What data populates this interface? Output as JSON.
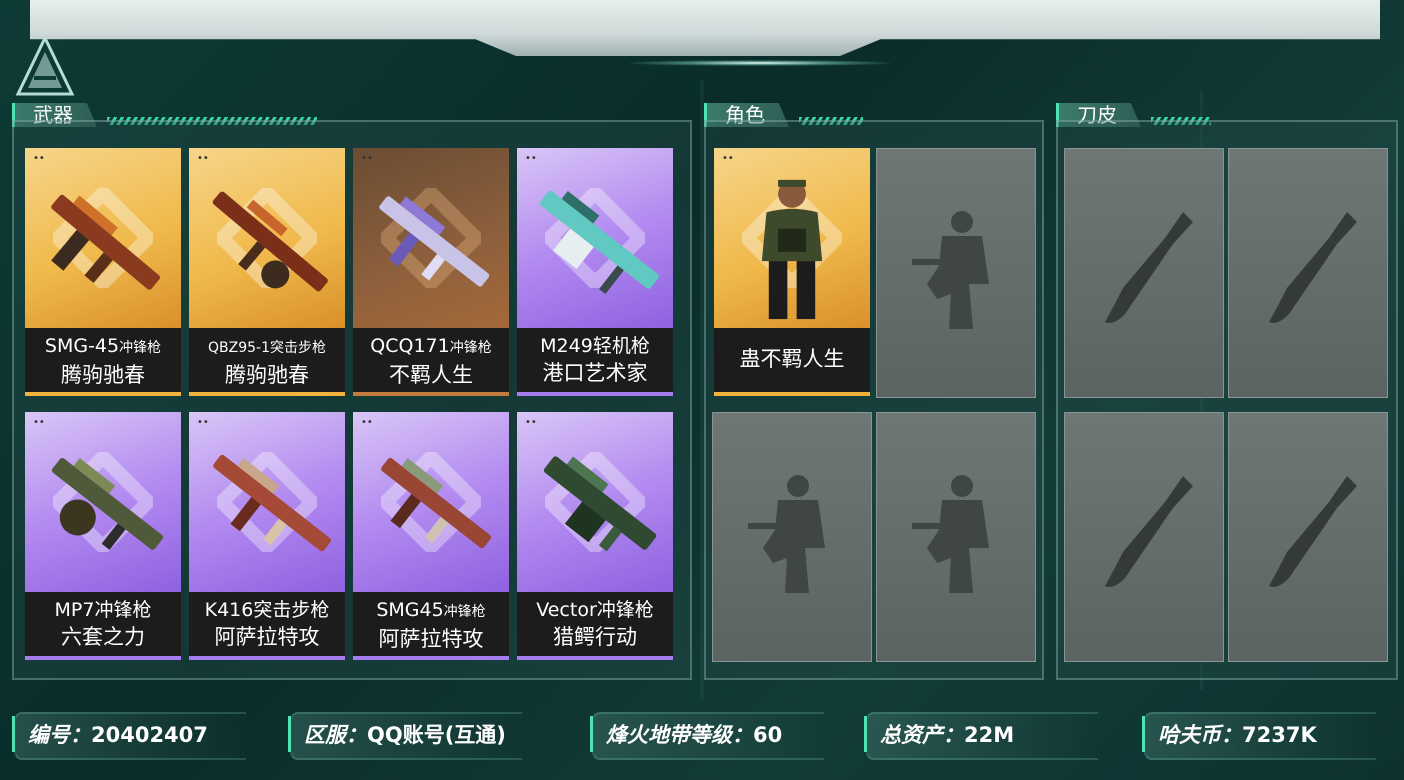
{
  "sections": {
    "weapons": "武器",
    "characters": "角色",
    "knives": "刀皮"
  },
  "weapons": [
    {
      "name": "SMG-45",
      "type": "冲锋枪",
      "skin": "腾驹驰春",
      "rarity": "gold"
    },
    {
      "name": "QBZ95-1",
      "type": "突击步枪",
      "skin": "腾驹驰春",
      "rarity": "gold"
    },
    {
      "name": "QCQ171",
      "type": "冲锋枪",
      "skin": "不羁人生",
      "rarity": "bronze"
    },
    {
      "name": "M249",
      "type": "轻机枪",
      "skin": "港口艺术家",
      "rarity": "purple"
    },
    {
      "name": "MP7",
      "type": "冲锋枪",
      "skin": "六套之力",
      "rarity": "purple"
    },
    {
      "name": "K416",
      "type": "突击步枪",
      "skin": "阿萨拉特攻",
      "rarity": "purple"
    },
    {
      "name": "SMG45",
      "type": "冲锋枪",
      "skin": "阿萨拉特攻",
      "rarity": "purple"
    },
    {
      "name": "Vector",
      "type": "冲锋枪",
      "skin": "猎鳄行动",
      "rarity": "purple"
    }
  ],
  "characters": [
    {
      "name": "蛊不羁人生",
      "rarity": "gold"
    }
  ],
  "info": {
    "id_label": "编号：",
    "id_value": "20402407",
    "server_label": "区服：",
    "server_value": "QQ账号(互通)",
    "level_label": "烽火地带等级：",
    "level_value": "60",
    "assets_label": "总资产：",
    "assets_value": "22M",
    "coin_label": "哈夫币：",
    "coin_value": "7237K"
  }
}
